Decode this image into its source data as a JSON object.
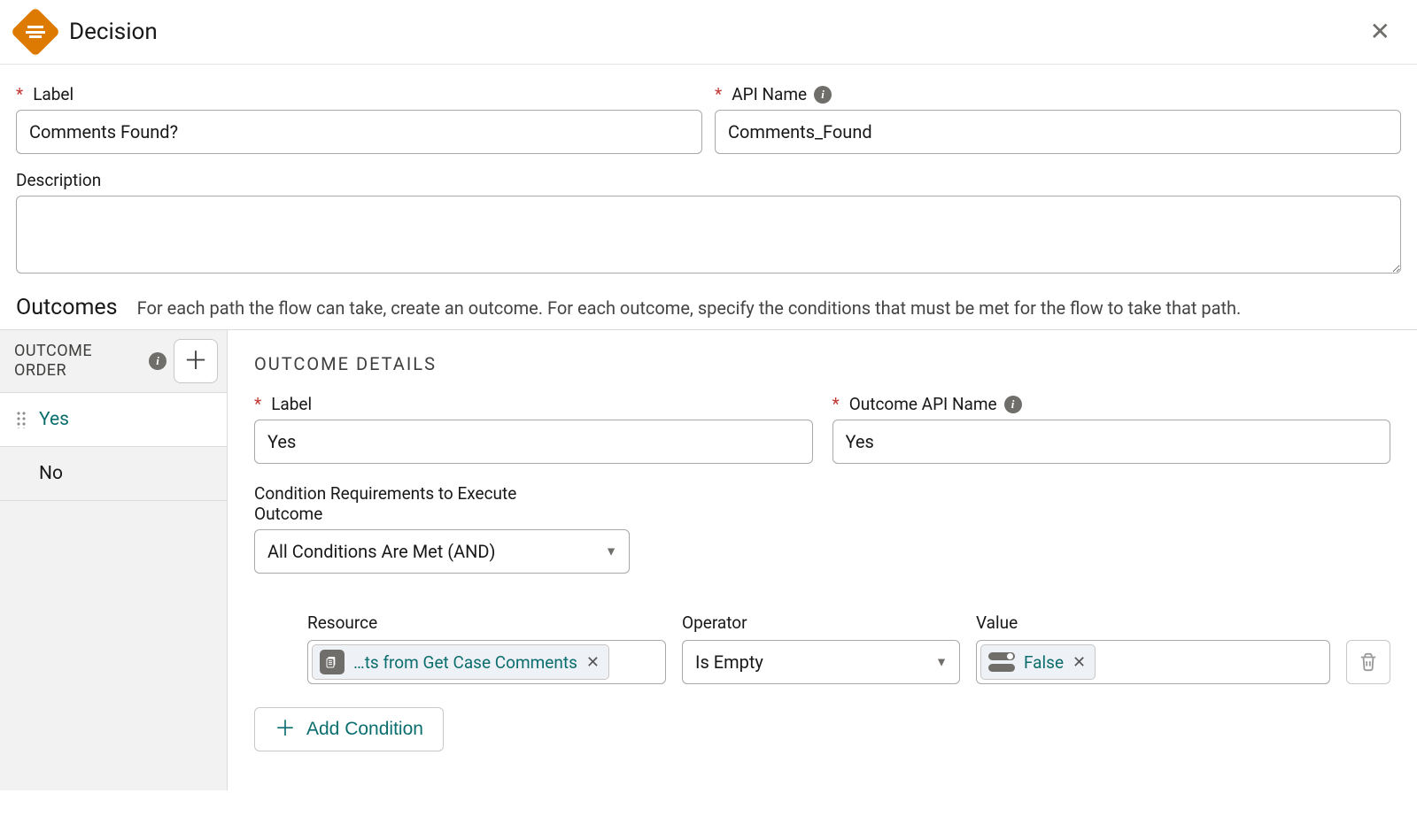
{
  "header": {
    "title": "Decision"
  },
  "form": {
    "label_field_label": "Label",
    "label_value": "Comments Found?",
    "api_name_label": "API Name",
    "api_name_value": "Comments_Found",
    "description_label": "Description",
    "description_value": ""
  },
  "outcomes_section": {
    "title": "Outcomes",
    "subtitle": "For each path the flow can take, create an outcome. For each outcome, specify the conditions that must be met for the flow to take that path."
  },
  "sidebar": {
    "header": "OUTCOME ORDER",
    "items": [
      {
        "label": "Yes",
        "selected": true
      },
      {
        "label": "No",
        "selected": false
      }
    ]
  },
  "details": {
    "header": "OUTCOME DETAILS",
    "outcome_label_label": "Label",
    "outcome_label_value": "Yes",
    "outcome_api_label": "Outcome API Name",
    "outcome_api_value": "Yes",
    "cond_req_label": "Condition Requirements to Execute Outcome",
    "cond_req_value": "All Conditions Are Met (AND)",
    "condition": {
      "resource_label": "Resource",
      "resource_value": "…ts from Get Case Comments",
      "operator_label": "Operator",
      "operator_value": "Is Empty",
      "value_label": "Value",
      "value_value": "False"
    },
    "add_condition_label": "Add Condition"
  }
}
